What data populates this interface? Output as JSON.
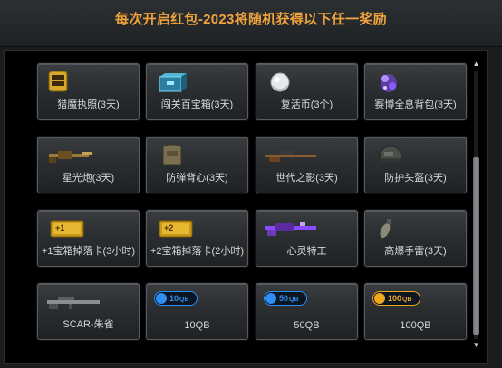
{
  "header": {
    "title": "每次开启红包-2023将随机获得以下任一奖励"
  },
  "rewards": [
    {
      "label": "猎魔执照(3天)",
      "icon": "license-icon"
    },
    {
      "label": "闯关百宝箱(3天)",
      "icon": "treasure-box-icon"
    },
    {
      "label": "复活币(3个)",
      "icon": "revive-coin-icon"
    },
    {
      "label": "赛博全息背包(3天)",
      "icon": "holo-backpack-icon"
    },
    {
      "label": "星光炮(3天)",
      "icon": "starlight-cannon-icon"
    },
    {
      "label": "防弹背心(3天)",
      "icon": "bulletproof-vest-icon"
    },
    {
      "label": "世代之影(3天)",
      "icon": "sniper-rifle-icon"
    },
    {
      "label": "防护头盔(3天)",
      "icon": "helmet-icon"
    },
    {
      "label": "+1宝箱掉落卡(3小时)",
      "icon": "drop-card-icon",
      "badge": "+1"
    },
    {
      "label": "+2宝箱掉落卡(2小时)",
      "icon": "drop-card-icon",
      "badge": "+2"
    },
    {
      "label": "心灵特工",
      "icon": "purple-rifle-icon"
    },
    {
      "label": "高爆手雷(3天)",
      "icon": "grenade-icon"
    },
    {
      "label": "SCAR-朱雀",
      "icon": "scar-rifle-icon"
    },
    {
      "label": "10QB",
      "icon": "qb-coin-icon",
      "badge": "10",
      "badge_unit": "QB",
      "badge_color": "#2f8ff0"
    },
    {
      "label": "50QB",
      "icon": "qb-coin-icon",
      "badge": "50",
      "badge_unit": "QB",
      "badge_color": "#2f8ff0"
    },
    {
      "label": "100QB",
      "icon": "qb-coin-icon",
      "badge": "100",
      "badge_unit": "QB",
      "badge_color": "#f0a81e"
    }
  ],
  "colors": {
    "title": "#f1a33b",
    "qb_blue": "#2f8ff0",
    "qb_gold": "#f0a81e"
  }
}
